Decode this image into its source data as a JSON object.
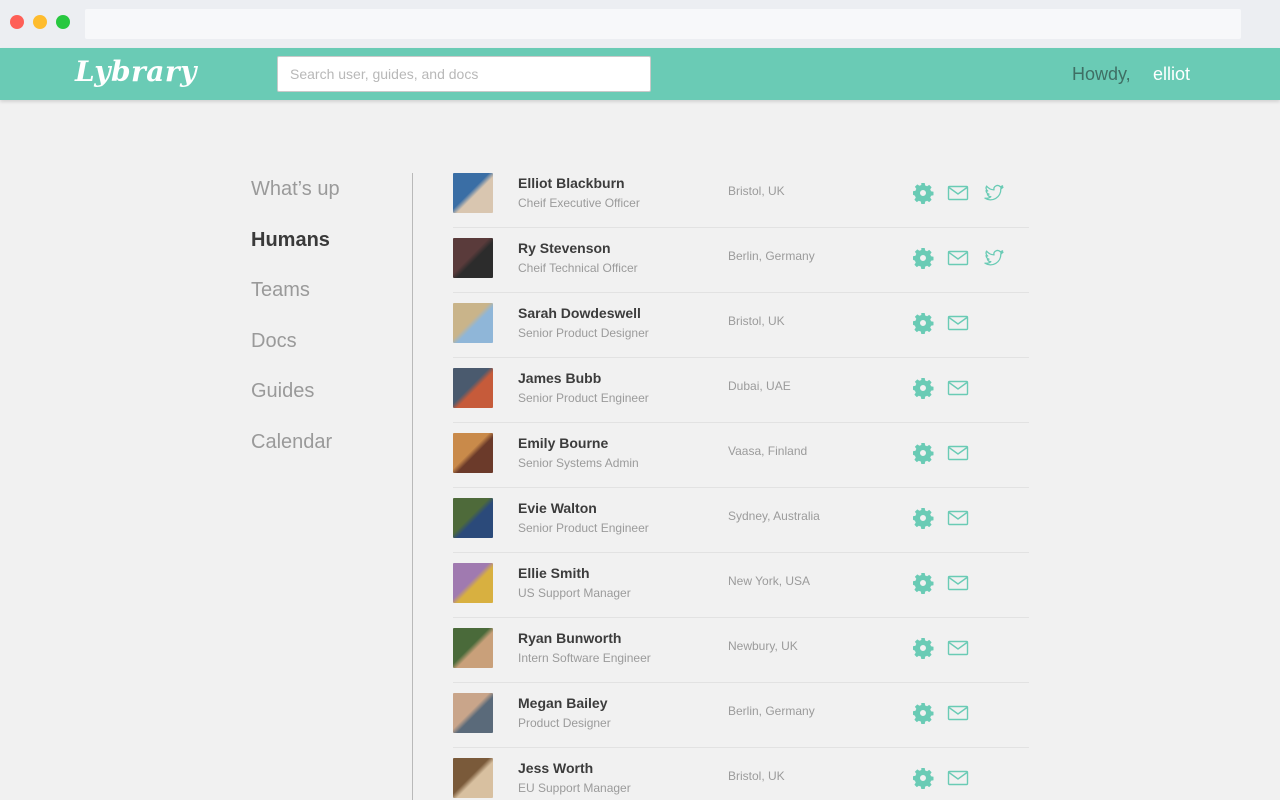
{
  "header": {
    "logo": "Lybrary",
    "search_placeholder": "Search user, guides, and docs",
    "greeting": "Howdy,",
    "username": "elliot"
  },
  "nav": [
    "What’s up",
    "Humans",
    "Teams",
    "Docs",
    "Guides",
    "Calendar"
  ],
  "active_nav": "Humans",
  "colors": {
    "accent": "#6acbb5",
    "icon": "#6acbb5"
  },
  "people": [
    {
      "name": "Elliot Blackburn",
      "role": "Cheif Executive Officer",
      "location": "Bristol, UK",
      "icons": [
        "gear-icon",
        "mail-icon",
        "twitter-icon"
      ]
    },
    {
      "name": "Ry Stevenson",
      "role": "Cheif Technical Officer",
      "location": "Berlin, Germany",
      "icons": [
        "gear-icon",
        "mail-icon",
        "twitter-icon"
      ]
    },
    {
      "name": "Sarah Dowdeswell",
      "role": "Senior Product Designer",
      "location": "Bristol, UK",
      "icons": [
        "gear-icon",
        "mail-icon"
      ]
    },
    {
      "name": "James Bubb",
      "role": "Senior Product Engineer",
      "location": "Dubai, UAE",
      "icons": [
        "gear-icon",
        "mail-icon"
      ]
    },
    {
      "name": "Emily Bourne",
      "role": "Senior Systems Admin",
      "location": "Vaasa, Finland",
      "icons": [
        "gear-icon",
        "mail-icon"
      ]
    },
    {
      "name": "Evie Walton",
      "role": "Senior Product Engineer",
      "location": "Sydney, Australia",
      "icons": [
        "gear-icon",
        "mail-icon"
      ]
    },
    {
      "name": "Ellie Smith",
      "role": "US Support Manager",
      "location": "New York, USA",
      "icons": [
        "gear-icon",
        "mail-icon"
      ]
    },
    {
      "name": "Ryan Bunworth",
      "role": "Intern Software Engineer",
      "location": "Newbury, UK",
      "icons": [
        "gear-icon",
        "mail-icon"
      ]
    },
    {
      "name": "Megan Bailey",
      "role": "Product Designer",
      "location": "Berlin, Germany",
      "icons": [
        "gear-icon",
        "mail-icon"
      ]
    },
    {
      "name": "Jess Worth",
      "role": "EU Support Manager",
      "location": "Bristol, UK",
      "icons": [
        "gear-icon",
        "mail-icon"
      ]
    }
  ]
}
